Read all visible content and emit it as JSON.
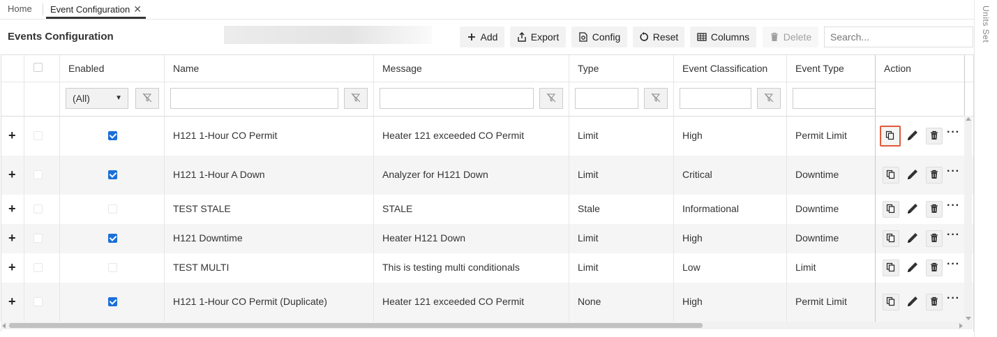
{
  "tabs": {
    "home": "Home",
    "active": "Event Configuration",
    "close_glyph": "✕"
  },
  "side_panel": {
    "label": "Units Set"
  },
  "page": {
    "title": "Events Configuration"
  },
  "toolbar": {
    "add": "Add",
    "export": "Export",
    "config": "Config",
    "reset": "Reset",
    "columns": "Columns",
    "delete": "Delete",
    "search_placeholder": "Search..."
  },
  "columns": {
    "enabled": "Enabled",
    "name": "Name",
    "message": "Message",
    "type": "Type",
    "event_classification": "Event Classification",
    "event_type": "Event Type",
    "action": "Action"
  },
  "filters": {
    "enabled_value": "(All)"
  },
  "rows": [
    {
      "enabled": true,
      "name": "H121 1-Hour CO Permit",
      "message": "Heater 121 exceeded CO Permit",
      "type": "Limit",
      "classification": "High",
      "event_type": "Permit Limit"
    },
    {
      "enabled": true,
      "name": "H121 1-Hour A Down",
      "message": "Analyzer for H121 Down",
      "type": "Limit",
      "classification": "Critical",
      "event_type": "Downtime"
    },
    {
      "enabled": false,
      "name": "TEST STALE",
      "message": "STALE",
      "type": "Stale",
      "classification": "Informational",
      "event_type": "Downtime"
    },
    {
      "enabled": true,
      "name": "H121 Downtime",
      "message": "Heater H121 Down",
      "type": "Limit",
      "classification": "High",
      "event_type": "Downtime"
    },
    {
      "enabled": false,
      "name": "TEST MULTI",
      "message": "This is testing multi conditionals",
      "type": "Limit",
      "classification": "Low",
      "event_type": "Limit"
    },
    {
      "enabled": true,
      "name": "H121 1-Hour CO Permit (Duplicate)",
      "message": "Heater 121 exceeded CO Permit",
      "type": "None",
      "classification": "High",
      "event_type": "Permit Limit"
    }
  ],
  "icons": {
    "add": "plus-icon",
    "export": "export-icon",
    "config": "config-icon",
    "reset": "reset-icon",
    "columns": "columns-icon",
    "delete": "trash-icon",
    "copy": "copy-icon",
    "edit": "pencil-icon",
    "more": "more-icon",
    "filter_clear": "filter-clear-icon"
  },
  "colors": {
    "checkbox_on": "#1a6fd8",
    "highlight": "#e05a3a"
  }
}
